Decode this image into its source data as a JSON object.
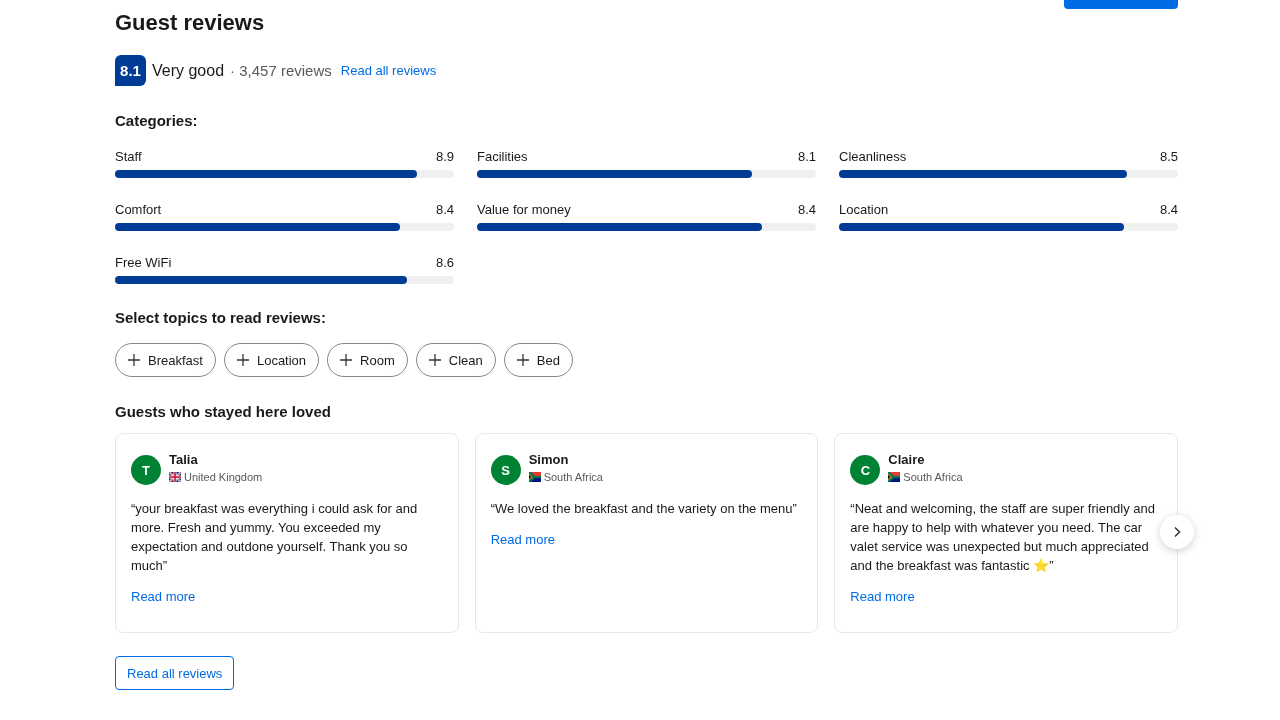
{
  "title": "Guest reviews",
  "summary": {
    "score": "8.1",
    "rating": "Very good",
    "count": "· 3,457 reviews",
    "link": "Read all reviews"
  },
  "categories_heading": "Categories:",
  "categories": [
    {
      "name": "Staff",
      "score": "8.9",
      "level": 0.89
    },
    {
      "name": "Facilities",
      "score": "8.1",
      "level": 0.81
    },
    {
      "name": "Cleanliness",
      "score": "8.5",
      "level": 0.85
    },
    {
      "name": "Comfort",
      "score": "8.4",
      "level": 0.84
    },
    {
      "name": "Value for money",
      "score": "8.4",
      "level": 0.84
    },
    {
      "name": "Location",
      "score": "8.4",
      "level": 0.84
    },
    {
      "name": "Free WiFi",
      "score": "8.6",
      "level": 0.86
    }
  ],
  "topics_heading": "Select topics to read reviews:",
  "topics": [
    "Breakfast",
    "Location",
    "Room",
    "Clean",
    "Bed"
  ],
  "loved_heading": "Guests who stayed here loved",
  "reviews": [
    {
      "initial": "T",
      "name": "Talia",
      "kind": "uk",
      "country": "United Kingdom",
      "text": "“your breakfast was everything i could ask for and more. Fresh and yummy. You exceeded my expectation and outdone yourself. Thank you so much”",
      "link": "Read more"
    },
    {
      "initial": "S",
      "name": "Simon",
      "kind": "za",
      "country": "South Africa",
      "text": "“We loved the breakfast and the variety on the menu”",
      "link": "Read more"
    },
    {
      "initial": "C",
      "name": "Claire",
      "kind": "za",
      "country": "South Africa",
      "text": "“Neat and welcoming, the staff are super friendly and are happy to help with whatever you need. The car valet service was unexpected but much appreciated and the breakfast was fantastic ⭐”",
      "link": "Read more"
    }
  ],
  "button": "Read all reviews"
}
